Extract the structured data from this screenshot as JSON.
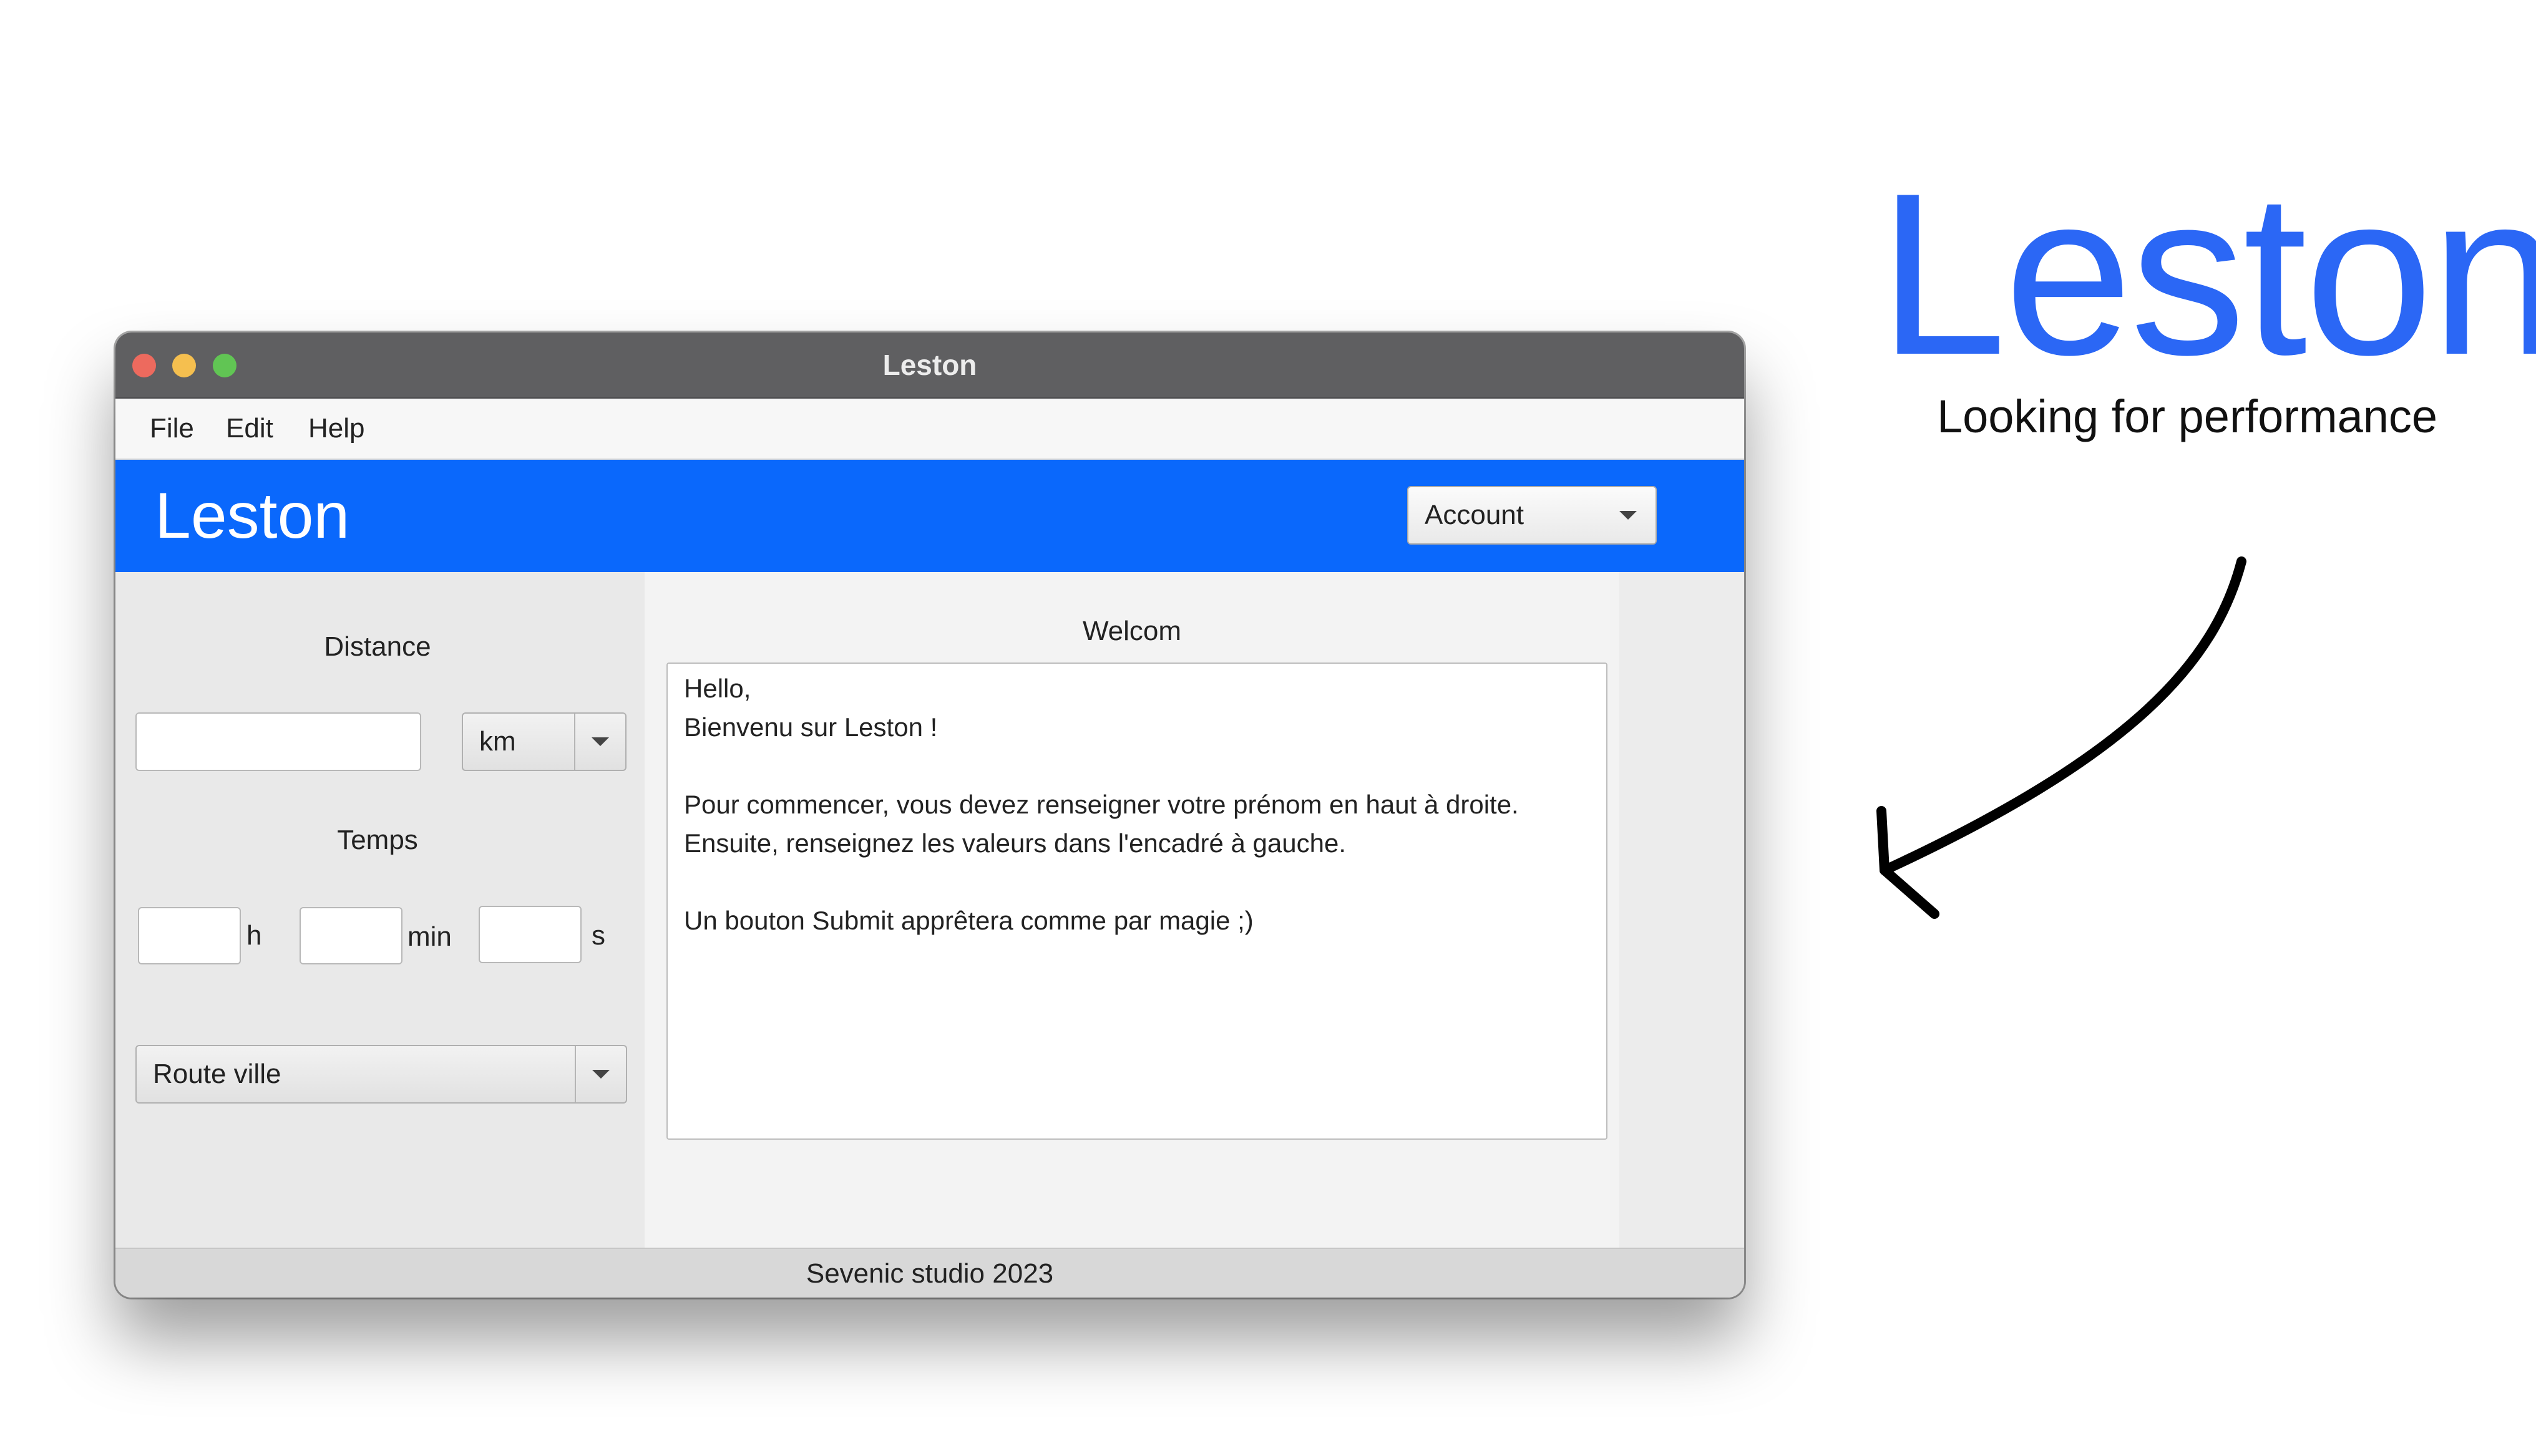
{
  "window": {
    "title": "Leston",
    "menu": [
      "File",
      "Edit",
      "Help"
    ]
  },
  "header": {
    "app_name": "Leston",
    "account_select": {
      "selected": "Account",
      "icon": "chevron-down-icon"
    }
  },
  "left_panel": {
    "distance_label": "Distance",
    "distance_value": "",
    "distance_unit": "km",
    "temps_label": "Temps",
    "time_fields": [
      {
        "value": "",
        "unit": "h"
      },
      {
        "value": "",
        "unit": "min"
      },
      {
        "value": "",
        "unit": "s"
      }
    ],
    "terrain_select": "Route ville"
  },
  "center_panel": {
    "title": "Welcom",
    "message_lines": [
      "Hello,",
      "Bienvenu sur Leston !",
      "",
      "Pour commencer, vous devez renseigner votre prénom en haut à droite.",
      "Ensuite, renseignez les valeurs dans l'encadré à gauche.",
      "",
      "Un bouton Submit apprêtera comme par magie ;)"
    ]
  },
  "status_bar": {
    "text": "Sevenic studio 2023"
  },
  "promo": {
    "brand": "Leston",
    "tagline": "Looking for performance",
    "arrow_icon": "curved-arrow-icon"
  },
  "colors": {
    "accent": "#0a68fc",
    "brand_text": "#2b67f5",
    "titlebar": "#5f5f61"
  }
}
